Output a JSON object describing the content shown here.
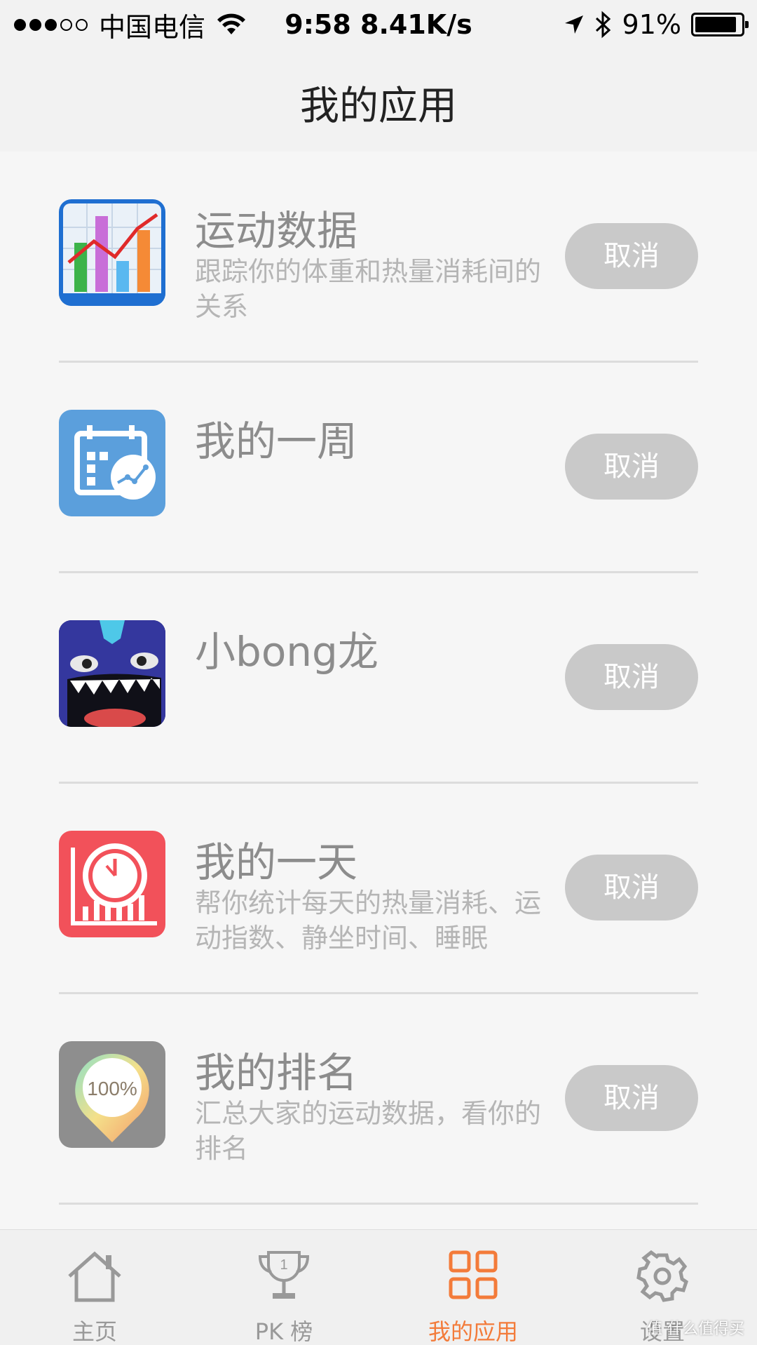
{
  "status_bar": {
    "carrier": "中国电信",
    "time_speed": "9:58 8.41K/s",
    "battery_percent": "91%",
    "battery_level": 0.91
  },
  "header": {
    "title": "我的应用"
  },
  "apps": [
    {
      "name": "运动数据",
      "description": "跟踪你的体重和热量消耗间的关系",
      "button": "取消",
      "icon": "bar-chart-icon"
    },
    {
      "name": "我的一周",
      "description": "",
      "button": "取消",
      "icon": "weekly-calendar-icon"
    },
    {
      "name": "小bong龙",
      "description": "",
      "button": "取消",
      "icon": "monster-icon"
    },
    {
      "name": "我的一天",
      "description": "帮你统计每天的热量消耗、运动指数、静坐时间、睡眠",
      "button": "取消",
      "icon": "daily-clock-icon"
    },
    {
      "name": "我的排名",
      "description": "汇总大家的运动数据，看你的排名",
      "button": "取消",
      "icon": "ranking-pin-icon",
      "badge": "100%"
    }
  ],
  "tabs": [
    {
      "label": "主页",
      "icon": "home-icon",
      "active": false
    },
    {
      "label": "PK 榜",
      "icon": "trophy-icon",
      "active": false
    },
    {
      "label": "我的应用",
      "icon": "apps-grid-icon",
      "active": true
    },
    {
      "label": "设置",
      "icon": "gear-icon",
      "active": false
    }
  ],
  "colors": {
    "accent": "#f37b3a",
    "button_bg": "#c9c9c9"
  },
  "watermark": "值 什么值得买"
}
